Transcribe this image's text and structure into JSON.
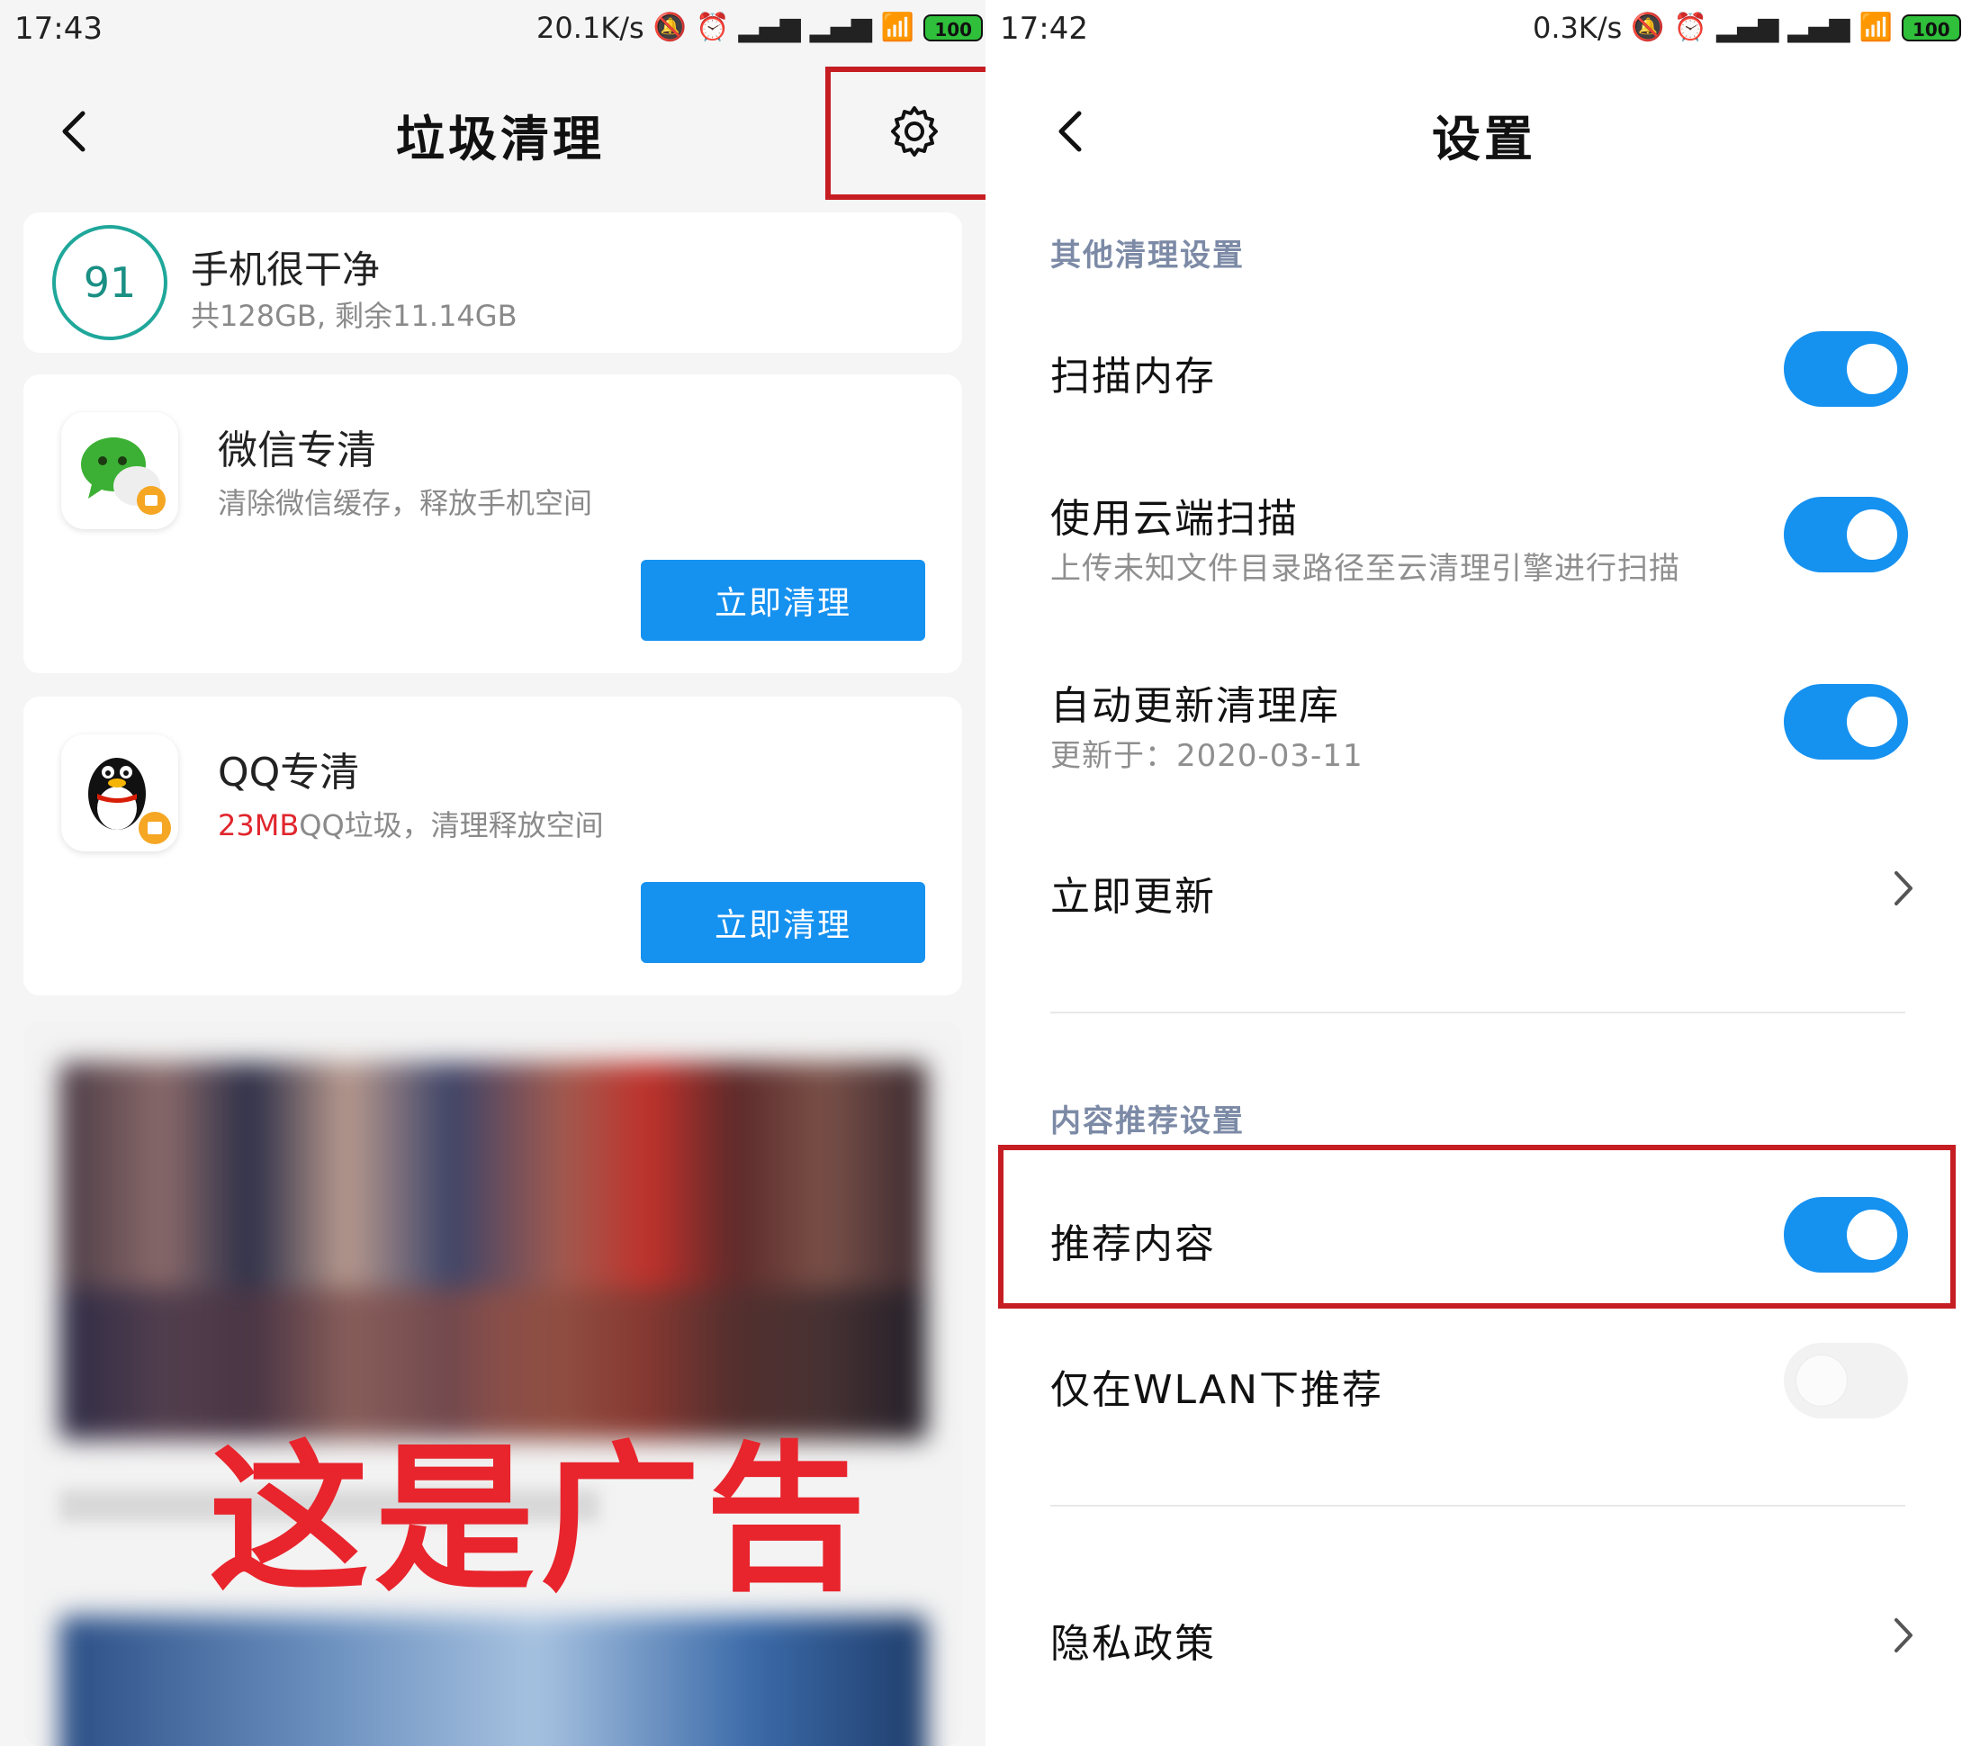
{
  "left": {
    "status_bar": {
      "time": "17:43",
      "net_speed": "20.1K/s",
      "battery": "100"
    },
    "nav": {
      "title": "垃圾清理"
    },
    "storage": {
      "score": "91",
      "title": "手机很干净",
      "subtitle": "共128GB, 剩余11.14GB"
    },
    "wechat": {
      "title": "微信专清",
      "desc": "清除微信缓存，释放手机空间",
      "button": "立即清理"
    },
    "qq": {
      "title": "QQ专清",
      "desc_highlight": "23MB",
      "desc_rest": "QQ垃圾，清理释放空间",
      "button": "立即清理"
    },
    "ad": {
      "label": "这是广告"
    }
  },
  "right": {
    "status_bar": {
      "time": "17:42",
      "net_speed": "0.3K/s",
      "battery": "100"
    },
    "nav": {
      "title": "设置"
    },
    "section_other": "其他清理设置",
    "scan_memory": {
      "title": "扫描内存",
      "enabled": true
    },
    "cloud_scan": {
      "title": "使用云端扫描",
      "subtitle": "上传未知文件目录路径至云清理引擎进行扫描",
      "enabled": true
    },
    "auto_update": {
      "title": "自动更新清理库",
      "subtitle": "更新于：2020-03-11",
      "enabled": true
    },
    "update_now": {
      "title": "立即更新"
    },
    "section_content": "内容推荐设置",
    "recommend": {
      "title": "推荐内容",
      "enabled": true
    },
    "wlan_only": {
      "title": "仅在WLAN下推荐",
      "enabled": false
    },
    "privacy": {
      "title": "隐私政策"
    }
  },
  "colors": {
    "accent": "#1591f0",
    "highlight": "#c61d22",
    "ad_red": "#e8242c",
    "score_ring": "#1fa79a"
  },
  "icons": [
    "back-icon",
    "settings-gear-icon",
    "wechat-icon",
    "qq-icon",
    "chevron-right-icon",
    "mute-icon",
    "alarm-icon",
    "signal-icon",
    "wifi-icon",
    "battery-icon",
    "charging-icon"
  ]
}
